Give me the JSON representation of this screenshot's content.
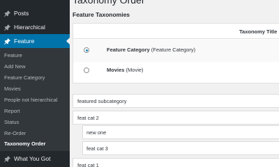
{
  "sidebar": {
    "top_items": [
      {
        "label": "Posts",
        "icon": "pin-icon"
      },
      {
        "label": "Hierarchical",
        "icon": "pin-icon"
      },
      {
        "label": "Feature",
        "icon": "pin-icon"
      }
    ],
    "submenu": [
      {
        "label": "Feature"
      },
      {
        "label": "Add New"
      },
      {
        "label": "Feature Category"
      },
      {
        "label": "Movies"
      },
      {
        "label": "People not hierarchical"
      },
      {
        "label": "Report"
      },
      {
        "label": "Status"
      },
      {
        "label": "Re-Order"
      },
      {
        "label": "Taxonomy Order"
      }
    ],
    "bottom_item": {
      "label": "What You Got",
      "icon": "pin-icon"
    }
  },
  "main": {
    "page_title": "Taxonomy Order",
    "section_title": "Feature Taxonomies",
    "table": {
      "header": "Taxonomy Title",
      "rows": [
        {
          "name": "Feature Category",
          "slug": "(Feature Category)",
          "selected": true
        },
        {
          "name": "Movies",
          "slug": "(Movie)",
          "selected": false
        }
      ]
    },
    "terms": [
      {
        "label": "featured subcategory",
        "level": 1
      },
      {
        "label": "feat cat 2",
        "level": 1
      },
      {
        "label": "new one",
        "level": 2
      },
      {
        "label": "feat cat 3",
        "level": 2
      },
      {
        "label": "feat cat 1",
        "level": 1
      }
    ]
  },
  "colors": {
    "sidebar_bg": "#23282d",
    "submenu_bg": "#32373c",
    "accent": "#0073aa",
    "page_bg": "#f1f1f1"
  }
}
